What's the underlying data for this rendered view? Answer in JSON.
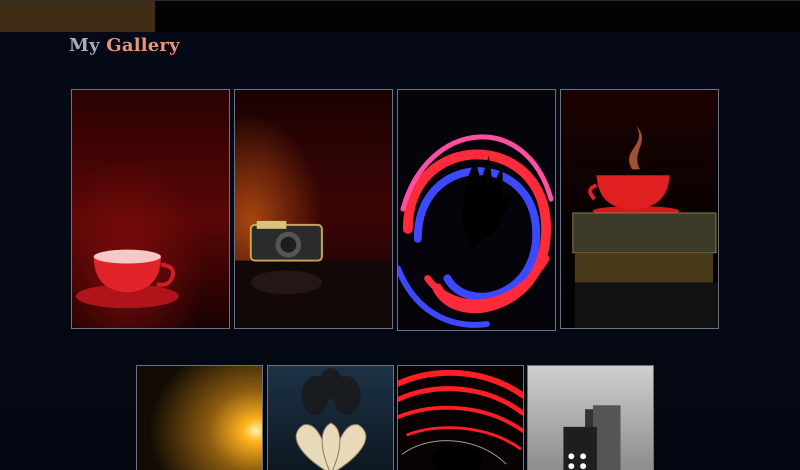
{
  "header": {
    "title_word1": "My",
    "title_word2": "Gallery"
  },
  "gallery": {
    "row1": [
      {
        "subject": "red-tea-cup"
      },
      {
        "subject": "vintage-camera"
      },
      {
        "subject": "light-painting-hand"
      },
      {
        "subject": "steaming-cup-on-books"
      }
    ],
    "row2": [
      {
        "subject": "golden-light-glow"
      },
      {
        "subject": "book-page-flower"
      },
      {
        "subject": "red-light-trails"
      },
      {
        "subject": "dominoes-black-white"
      }
    ]
  },
  "colors": {
    "title_primary": "#a9acbd",
    "title_accent": "#e8967a",
    "topbar_accent": "#3f2d15",
    "page_background": "#02060d"
  }
}
